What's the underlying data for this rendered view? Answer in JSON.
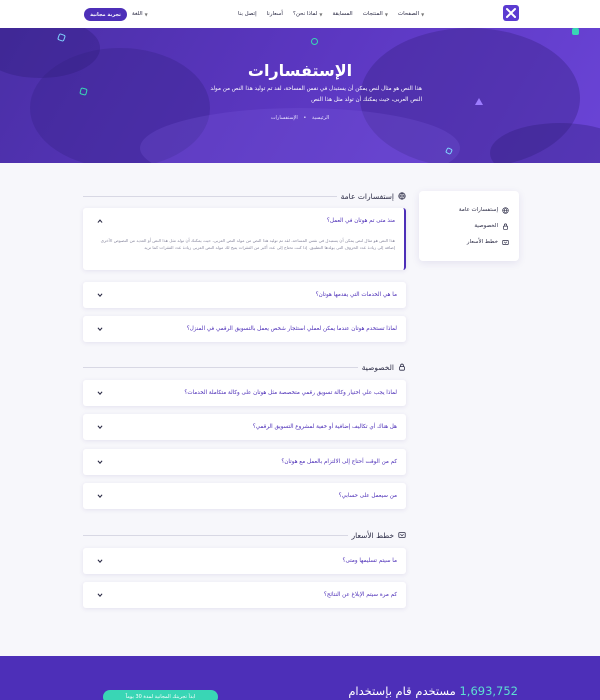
{
  "header": {
    "trial_button": "تجربة مجانية",
    "language": "اللغة",
    "nav": [
      {
        "label": "الصفحات",
        "dropdown": true
      },
      {
        "label": "المنتجات",
        "dropdown": true
      },
      {
        "label": "المسابقة",
        "dropdown": false
      },
      {
        "label": "لماذا نحن؟",
        "dropdown": true
      },
      {
        "label": "أسعارنا",
        "dropdown": false
      },
      {
        "label": "إتصل بنا",
        "dropdown": false
      }
    ]
  },
  "hero": {
    "title": "الإستفسارات",
    "description": "هذا النص هو مثال لنص يمكن أن يستبدل في نفس المساحة، لقد تم توليد هذا النص من مولد النص العربى، حيث يمكنك أن تولد مثل هذا النص",
    "breadcrumb_home": "الرئيسية",
    "breadcrumb_sep": "•",
    "breadcrumb_current": "الإستفسارات"
  },
  "sidebar": {
    "items": [
      {
        "label": "إستفسارات عامة",
        "icon": "globe-icon"
      },
      {
        "label": "الخصوصية",
        "icon": "lock-icon"
      },
      {
        "label": "خطط الأسعار",
        "icon": "pricing-card-icon"
      }
    ]
  },
  "sections": {
    "general": {
      "title": "إستفسارات عامة",
      "icon": "globe-icon",
      "questions": [
        {
          "q": "منذ متى تم هوتان في العمل؟",
          "open": true,
          "answer": "هذا النص هو مثال لنص يمكن أن يستبدل في نفس المساحة، لقد تم توليد هذا النص من مولد النص العربى، حيث يمكنك أن تولد مثل هذا النص أو العديد من النصوص الأخرى إضافة إلى زيادة عدد الحروف التى يولدها التطبيق. إذا كنت تحتاج إلى عدد أكبر من الفقرات يتيح لك مولد النص العربى زيادة عدد الفقرات كما تريد"
        },
        {
          "q": "ما هي الخدمات التي يقدمها هوتان؟",
          "open": false
        },
        {
          "q": "لماذا تستخدم هوتان عندما يمكن لعملي استئجار شخص يعمل بالتسويق الرقمي في المنزل؟",
          "open": false
        }
      ]
    },
    "privacy": {
      "title": "الخصوصية",
      "icon": "lock-icon",
      "questions": [
        {
          "q": "لماذا يجب علي اختيار وكالة تسويق رقمي متخصصة مثل هوتان على وكالة متكاملة الخدمات؟"
        },
        {
          "q": "هل هناك أي تكاليف إضافية أو خفية لمشروع التسويق الرقمي؟"
        },
        {
          "q": "كم من الوقت أحتاج إلى الالتزام بالعمل مع هوتان؟"
        },
        {
          "q": "من سيعمل على حسابي؟"
        }
      ]
    },
    "pricing": {
      "title": "خطط الأسعار",
      "icon": "pricing-card-icon",
      "questions": [
        {
          "q": "ما سيتم تسليمها ومتى؟"
        },
        {
          "q": "كم مرة سيتم الإبلاغ عن النتائج؟"
        }
      ]
    }
  },
  "stats": {
    "number": "1,693,752",
    "text": "مستخدم قام بإستخدام",
    "button": "ابدأ تجربتك المجانية لمدة 30 يوماً"
  },
  "colors": {
    "primary": "#4d2fb8",
    "accent": "#39d6b5",
    "hero_start": "#4a2fa6",
    "hero_end": "#6a44d6"
  }
}
